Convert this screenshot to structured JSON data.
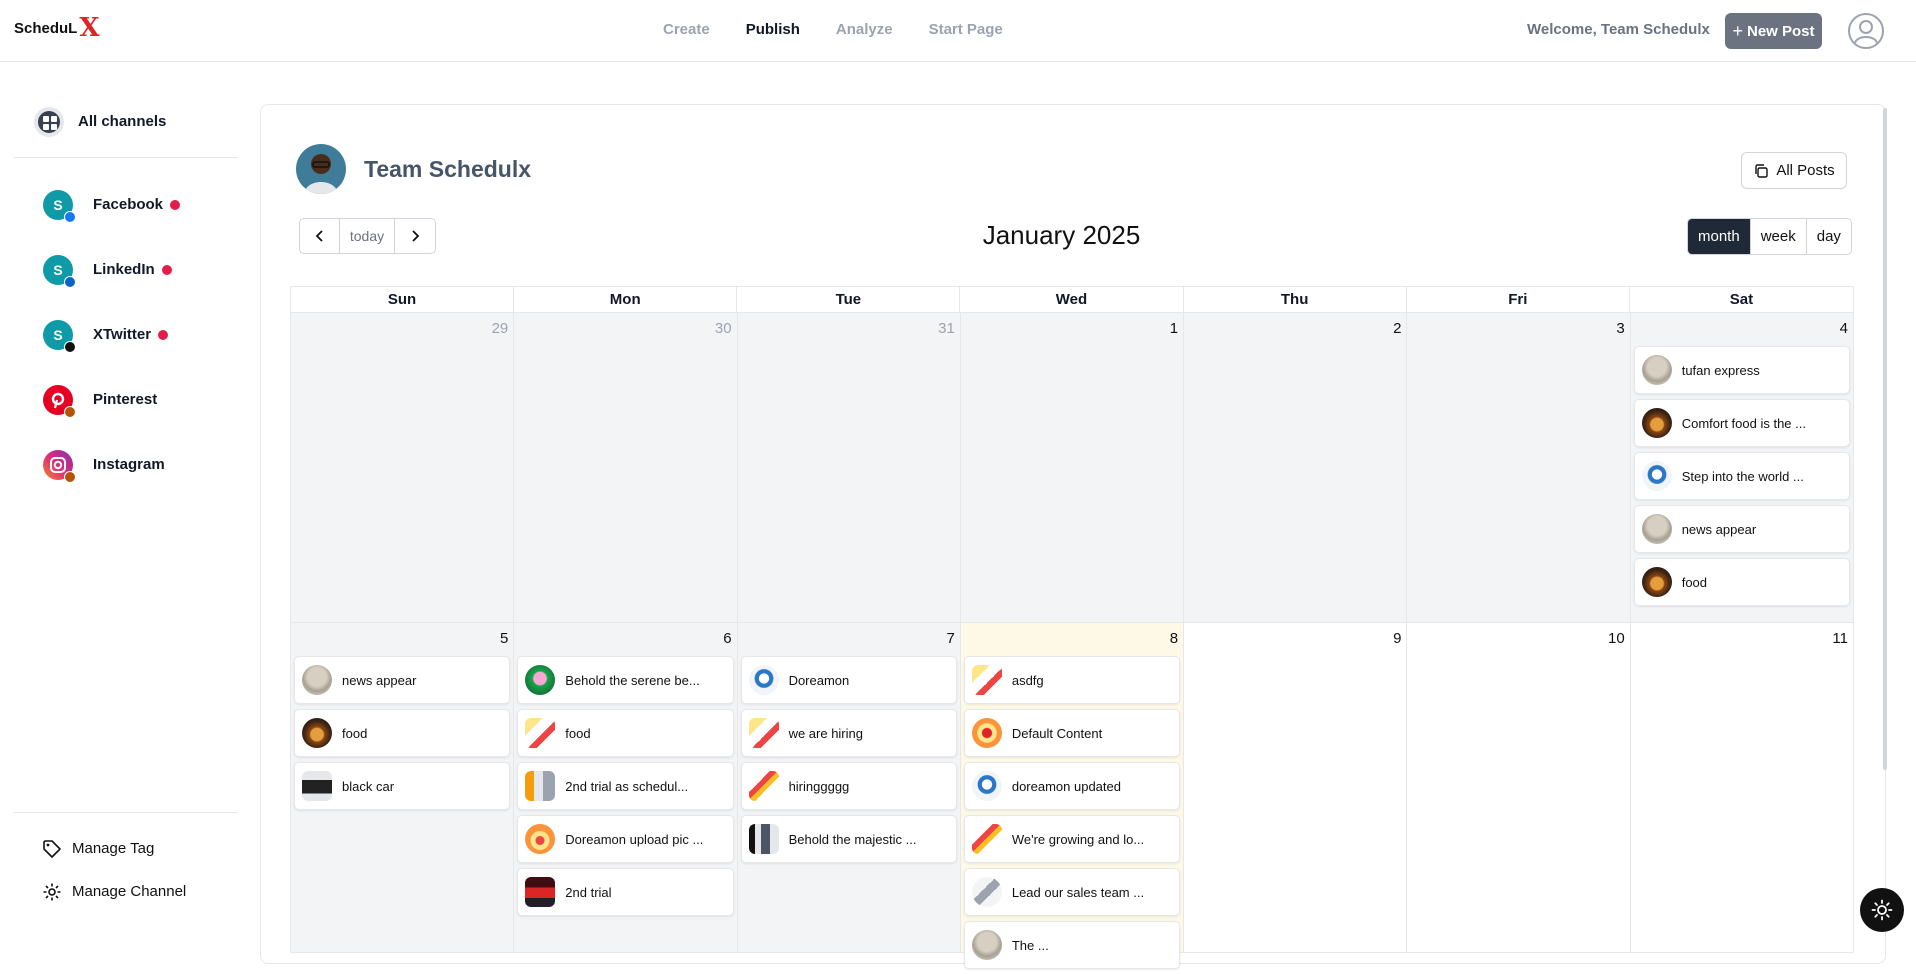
{
  "app": {
    "logo_text": "ScheduL",
    "logo_mark": "X"
  },
  "nav": {
    "items": [
      "Create",
      "Publish",
      "Analyze",
      "Start Page"
    ],
    "active": "Publish"
  },
  "header": {
    "welcome": "Welcome, Team Schedulx",
    "new_post_label": "New Post",
    "new_post_icon": "+"
  },
  "sidebar": {
    "all_channels": "All channels",
    "channels": [
      {
        "name": "Facebook",
        "avatar": "S",
        "platform": "facebook",
        "alert": true
      },
      {
        "name": "LinkedIn",
        "avatar": "S",
        "platform": "linkedin",
        "alert": true
      },
      {
        "name": "XTwitter",
        "avatar": "S",
        "platform": "x",
        "alert": true
      },
      {
        "name": "Pinterest",
        "avatar": "",
        "platform": "pinterest",
        "alert": false
      },
      {
        "name": "Instagram",
        "avatar": "",
        "platform": "instagram",
        "alert": false
      }
    ],
    "manage_tag": "Manage Tag",
    "manage_channel": "Manage Channel"
  },
  "profile": {
    "name": "Team Schedulx",
    "all_posts_label": "All Posts"
  },
  "calendar": {
    "title": "January 2025",
    "today_label": "today",
    "views": [
      "month",
      "week",
      "day"
    ],
    "active_view": "month",
    "weekdays": [
      "Sun",
      "Mon",
      "Tue",
      "Wed",
      "Thu",
      "Fri",
      "Sat"
    ],
    "week1": [
      {
        "day": "29",
        "muted": true,
        "past": true,
        "events": []
      },
      {
        "day": "30",
        "muted": true,
        "past": true,
        "events": []
      },
      {
        "day": "31",
        "muted": true,
        "past": true,
        "events": []
      },
      {
        "day": "1",
        "muted": false,
        "past": true,
        "events": []
      },
      {
        "day": "2",
        "muted": false,
        "past": true,
        "events": []
      },
      {
        "day": "3",
        "muted": false,
        "past": true,
        "events": []
      },
      {
        "day": "4",
        "muted": false,
        "past": true,
        "events": [
          {
            "text": "tufan express",
            "thumb": "t-news"
          },
          {
            "text": "Comfort food is the ...",
            "thumb": "t-food"
          },
          {
            "text": "Step into the world ...",
            "thumb": "t-dora"
          },
          {
            "text": "news appear",
            "thumb": "t-news"
          },
          {
            "text": "food",
            "thumb": "t-food"
          }
        ]
      }
    ],
    "week2": [
      {
        "day": "5",
        "muted": false,
        "past": true,
        "events": [
          {
            "text": "news appear",
            "thumb": "t-news"
          },
          {
            "text": "food",
            "thumb": "t-food"
          },
          {
            "text": "black car",
            "thumb": "t-car"
          }
        ]
      },
      {
        "day": "6",
        "muted": false,
        "past": true,
        "events": [
          {
            "text": "Behold the serene be...",
            "thumb": "t-lotus"
          },
          {
            "text": "food",
            "thumb": "t-hire"
          },
          {
            "text": "2nd trial as schedul...",
            "thumb": "t-trial"
          },
          {
            "text": "Doreamon upload pic ...",
            "thumb": "t-dora2"
          },
          {
            "text": "2nd trial",
            "thumb": "t-red"
          }
        ]
      },
      {
        "day": "7",
        "muted": false,
        "past": true,
        "events": [
          {
            "text": "Doreamon",
            "thumb": "t-dora"
          },
          {
            "text": "we are hiring",
            "thumb": "t-hire"
          },
          {
            "text": "hiringgggg",
            "thumb": "t-hire2"
          },
          {
            "text": "Behold the majestic ...",
            "thumb": "t-majestic"
          }
        ]
      },
      {
        "day": "8",
        "muted": false,
        "past": false,
        "today": true,
        "events": [
          {
            "text": "asdfg",
            "thumb": "t-hire"
          },
          {
            "text": "Default Content",
            "thumb": "t-default"
          },
          {
            "text": "doreamon updated",
            "thumb": "t-dora"
          },
          {
            "text": "We're growing and lo...",
            "thumb": "t-hire2"
          },
          {
            "text": "Lead our sales team ...",
            "thumb": "t-lead"
          },
          {
            "text": "The ...",
            "thumb": "t-news"
          }
        ]
      },
      {
        "day": "9",
        "muted": false,
        "past": false,
        "events": []
      },
      {
        "day": "10",
        "muted": false,
        "past": false,
        "events": []
      },
      {
        "day": "11",
        "muted": false,
        "past": false,
        "events": []
      }
    ]
  },
  "colors": {
    "accent": "#1f2937",
    "alert": "#e11d48",
    "today_bg": "#fef9e7",
    "past_bg": "#f3f4f6",
    "new_post_bg": "#6b7280"
  }
}
